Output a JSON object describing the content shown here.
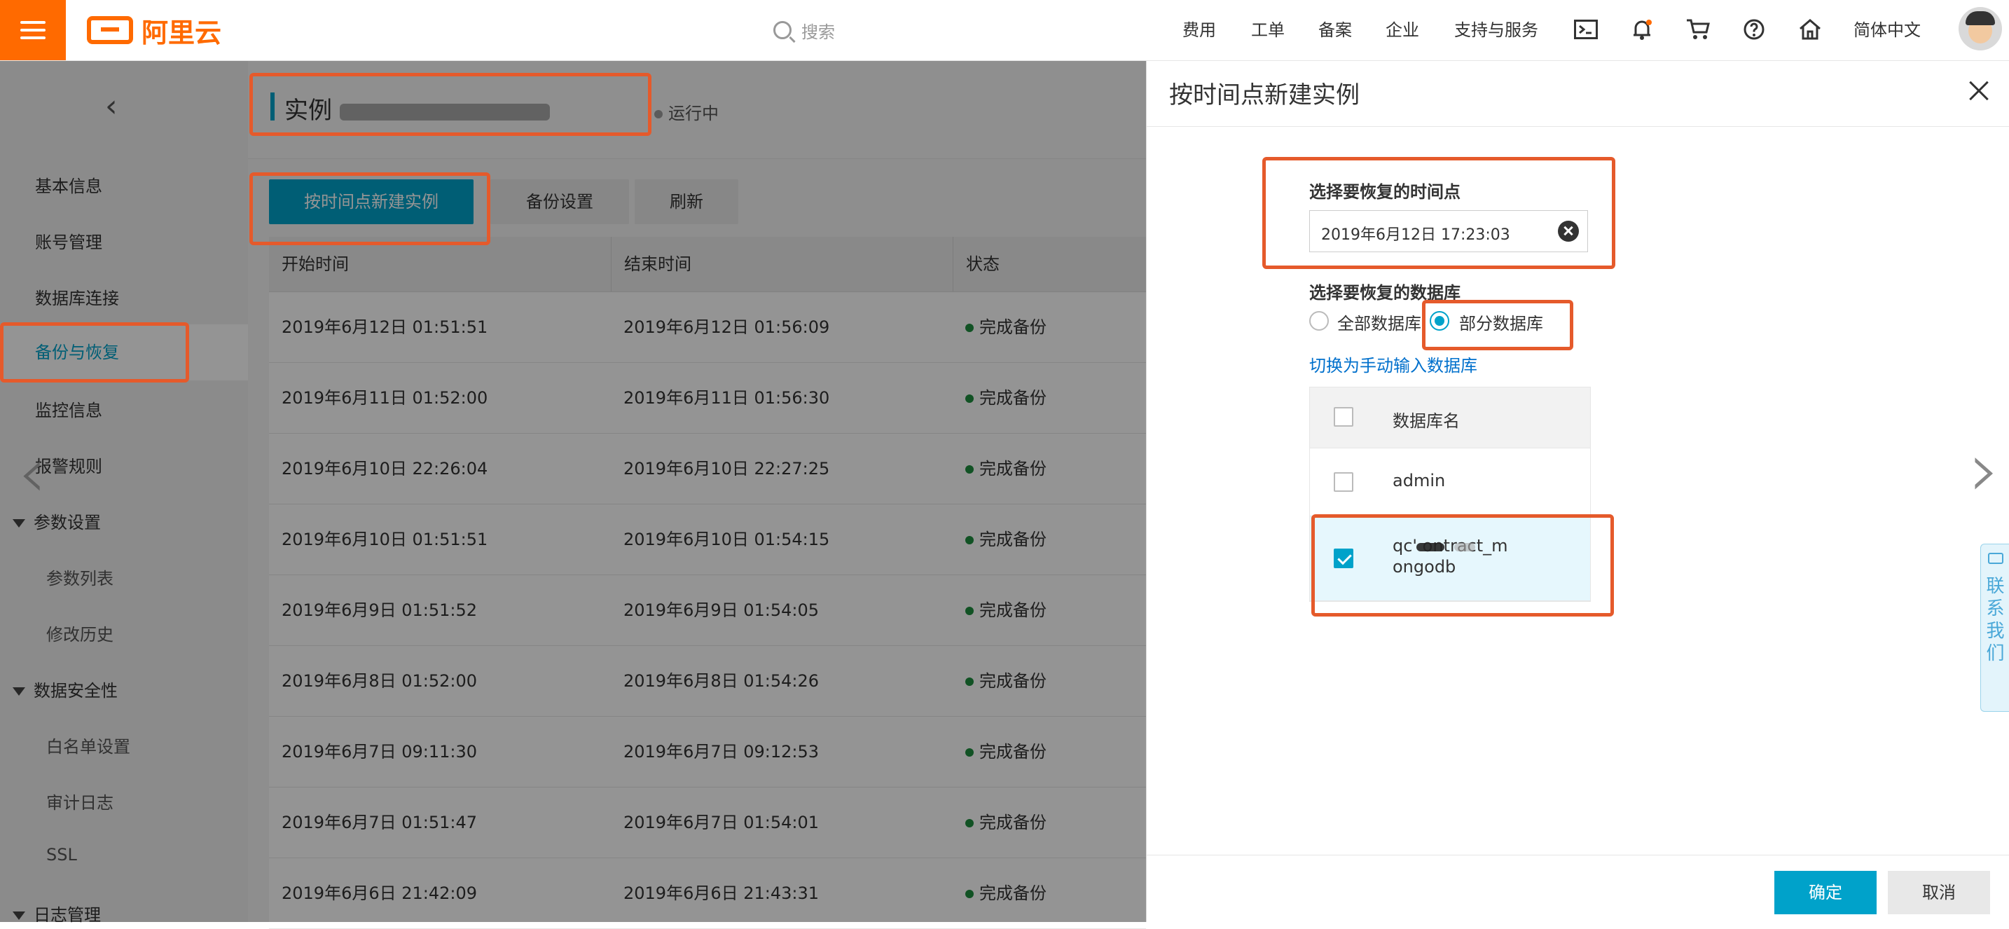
{
  "topbar": {
    "brand": "阿里云",
    "search_placeholder": "搜索",
    "nav": [
      "费用",
      "工单",
      "备案",
      "企业",
      "支持与服务"
    ],
    "language": "简体中文",
    "icons": [
      "terminal-icon",
      "bell-icon",
      "cart-icon",
      "help-icon",
      "home-icon"
    ]
  },
  "sidebar": {
    "items": [
      "基本信息",
      "账号管理",
      "数据库连接",
      "备份与恢复",
      "监控信息",
      "报警规则"
    ],
    "groups": [
      {
        "label": "参数设置",
        "children": [
          "参数列表",
          "修改历史"
        ]
      },
      {
        "label": "数据安全性",
        "children": [
          "白名单设置",
          "审计日志",
          "SSL"
        ]
      },
      {
        "label": "日志管理",
        "children": []
      }
    ]
  },
  "main": {
    "title_prefix": "实例",
    "status": "运行中",
    "buttons": {
      "restore": "按时间点新建实例",
      "backup_settings": "备份设置",
      "refresh": "刷新"
    },
    "table": {
      "headers": [
        "开始时间",
        "结束时间",
        "状态"
      ],
      "rows": [
        {
          "start": "2019年6月12日 01:51:51",
          "end": "2019年6月12日 01:56:09",
          "status": "完成备份"
        },
        {
          "start": "2019年6月11日 01:52:00",
          "end": "2019年6月11日 01:56:30",
          "status": "完成备份"
        },
        {
          "start": "2019年6月10日 22:26:04",
          "end": "2019年6月10日 22:27:25",
          "status": "完成备份"
        },
        {
          "start": "2019年6月10日 01:51:51",
          "end": "2019年6月10日 01:54:15",
          "status": "完成备份"
        },
        {
          "start": "2019年6月9日 01:51:52",
          "end": "2019年6月9日 01:54:05",
          "status": "完成备份"
        },
        {
          "start": "2019年6月8日 01:52:00",
          "end": "2019年6月8日 01:54:26",
          "status": "完成备份"
        },
        {
          "start": "2019年6月7日 09:11:30",
          "end": "2019年6月7日 09:12:53",
          "status": "完成备份"
        },
        {
          "start": "2019年6月7日 01:51:47",
          "end": "2019年6月7日 01:54:01",
          "status": "完成备份"
        },
        {
          "start": "2019年6月6日 21:42:09",
          "end": "2019年6月6日 21:43:31",
          "status": "完成备份"
        }
      ]
    }
  },
  "panel": {
    "title": "按时间点新建实例",
    "time_label": "选择要恢复的时间点",
    "time_value": "2019年6月12日 17:23:03",
    "db_label": "选择要恢复的数据库",
    "radio_all": "全部数据库",
    "radio_partial": "部分数据库",
    "switch_link": "切换为手动输入数据库",
    "db_header": "数据库名",
    "db_rows": [
      {
        "name": "admin",
        "checked": false
      },
      {
        "name_line1": "qc'   ontract_m",
        "name_line2": "ongodb",
        "checked": true
      }
    ],
    "contact": "联系我们",
    "ok": "确定",
    "cancel": "取消"
  },
  "colors": {
    "accent": "#00a2ca",
    "brand": "#ff6a00",
    "annotation": "#e55a2b",
    "success": "#1e8e3e"
  }
}
